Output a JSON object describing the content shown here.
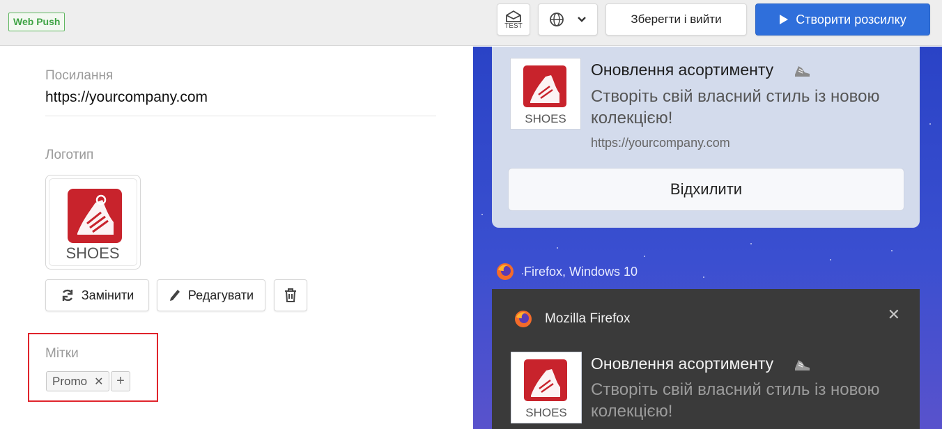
{
  "header": {
    "badge": "Web Push",
    "test_label": "TEST",
    "save_label": "Зберегти і вийти",
    "create_label": "Створити розсилку"
  },
  "form": {
    "link_label": "Посилання",
    "link_value": "https://yourcompany.com",
    "logo_label": "Логотип",
    "logo_text": "SHOES",
    "replace_label": "Замінити",
    "edit_label": "Редагувати",
    "tags_label": "Мітки",
    "tags": [
      "Promo"
    ]
  },
  "preview": {
    "chrome_card": {
      "title": "Оновлення асортименту",
      "body": "Створіть свій власний стиль із новою колекцією!",
      "url": "https://yourcompany.com",
      "logo_text": "SHOES",
      "dismiss_label": "Відхилити"
    },
    "firefox_platform": "Firefox, Windows 10",
    "firefox_card": {
      "app_name": "Mozilla Firefox",
      "title": "Оновлення асортименту",
      "body": "Створіть свій власний стиль із новою колекцією!",
      "logo_text": "SHOES"
    }
  },
  "colors": {
    "primary": "#2f6fdb",
    "badge_green": "#3fa444",
    "highlight_red": "#e0242c",
    "logo_red": "#c8232c",
    "preview_bg": "#2a43c6",
    "firefox_card_bg": "#3a3a3a"
  }
}
